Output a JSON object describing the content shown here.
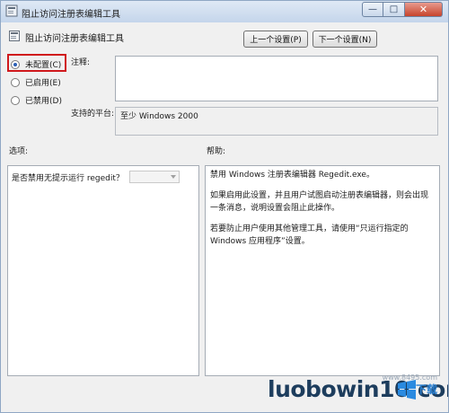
{
  "window": {
    "title": "阻止访问注册表编辑工具",
    "controls": {
      "minimize": "—",
      "maximize": "□",
      "close": "✕"
    }
  },
  "header": {
    "policy_name": "阻止访问注册表编辑工具",
    "prev_button": "上一个设置(P)",
    "next_button": "下一个设置(N)"
  },
  "state": {
    "options": [
      {
        "label": "未配置(C)",
        "selected": true
      },
      {
        "label": "已启用(E)",
        "selected": false
      },
      {
        "label": "已禁用(D)",
        "selected": false
      }
    ]
  },
  "comment": {
    "label": "注释:",
    "value": ""
  },
  "platform": {
    "label": "支持的平台:",
    "value": "至少 Windows 2000"
  },
  "options_section": {
    "label": "选项:",
    "item_label": "是否禁用无提示运行 regedit？",
    "item_value": ""
  },
  "help_section": {
    "label": "帮助:",
    "paragraphs": [
      "禁用 Windows 注册表编辑器 Regedit.exe。",
      "如果启用此设置，并且用户试图启动注册表编辑器，则会出现一条消息，说明设置会阻止此操作。",
      "若要防止用户使用其他管理工具，请使用“只运行指定的 Windows 应用程序”设置。"
    ]
  },
  "watermark": {
    "text": "luobowin10.com",
    "url": "www.8495.com",
    "extra": "下载"
  },
  "colors": {
    "highlight": "#d0181c",
    "titlebar": "#c4d5eb",
    "watermark_text": "#1d3d5d"
  }
}
